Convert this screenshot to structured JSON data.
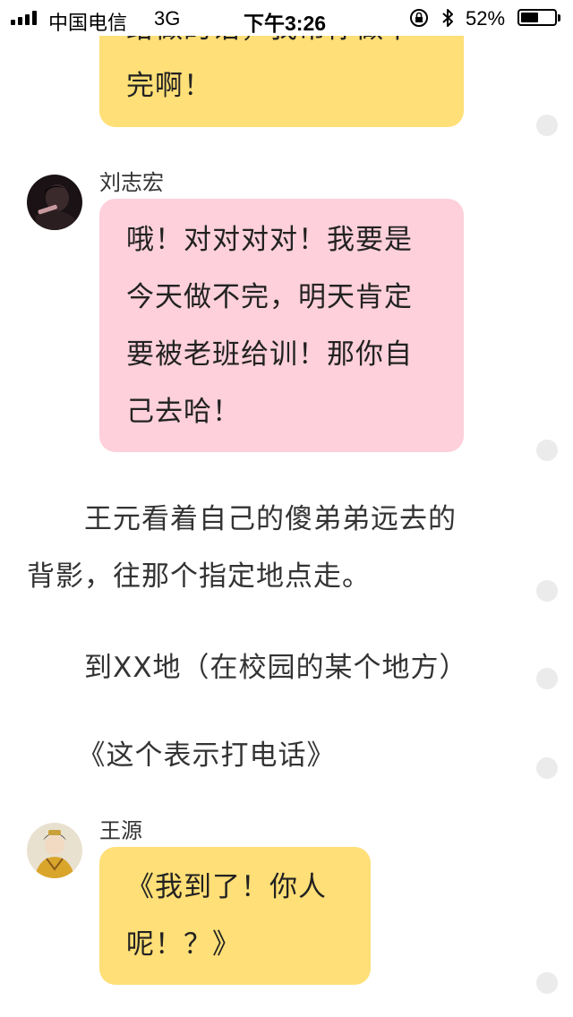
{
  "status_bar": {
    "carrier": "中国电信",
    "network": "3G",
    "time": "下午3:26",
    "battery_percent_label": "52%",
    "battery_level": 0.52
  },
  "story": {
    "message_1": {
      "partial_top_text": "给做的话，我帮你做下",
      "text": "完啊！",
      "bubble_color": "#ffdf77"
    },
    "message_2": {
      "speaker": "刘志宏",
      "lines": [
        "哦！对对对对！我要是",
        "今天做不完，明天肯定",
        "要被老班给训！那你自",
        "己去哈！"
      ],
      "bubble_color": "#fdd0db"
    },
    "narration_1": {
      "lines": [
        "　　王元看着自己的傻弟弟远去的",
        "背影，往那个指定地点走。"
      ]
    },
    "narration_2": "　　到XX地（在校园的某个地方）",
    "narration_3": "　《这个表示打电话》",
    "message_3": {
      "speaker": "王源",
      "lines": [
        "《我到了！你人",
        "呢！？》"
      ],
      "bubble_color": "#ffdf77"
    }
  }
}
